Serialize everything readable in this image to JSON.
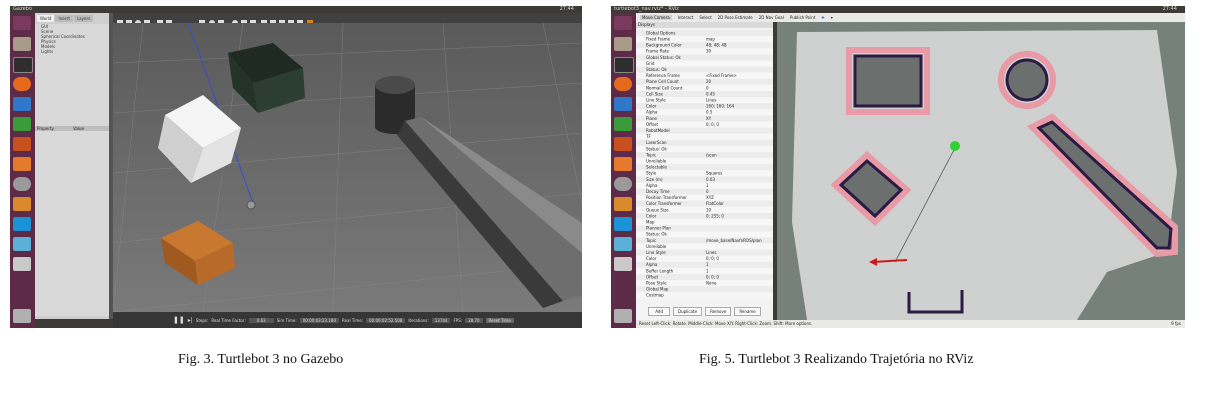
{
  "figures": [
    {
      "app_title": "Gazebo",
      "side_tabs": [
        "World",
        "Insert",
        "Layers"
      ],
      "tree_items": [
        "GUI",
        "Scene",
        "Spherical Coordinates",
        "Physics",
        "Models",
        "Lights"
      ],
      "prop_headers": [
        "Property",
        "Value"
      ],
      "status": {
        "steps": "Steps:",
        "rtf_label": "Real Time Factor:",
        "rtf": "0.63",
        "sim_label": "Sim Time:",
        "sim": "00:00:03:23.180",
        "real_label": "Real Time:",
        "real": "00:00:02:52.508",
        "iter_label": "Iterations:",
        "iter": "13744",
        "fps_label": "FPS:",
        "fps": "28.70",
        "reset": "Reset Time"
      },
      "tray": "27:44",
      "caption": "Fig. 3.   Turtlebot 3 no Gazebo"
    },
    {
      "app_title": "turtlebot3_nav.rviz* - RViz",
      "tools": [
        "Move Camera",
        "Interact",
        "Select",
        "2D Pose Estimate",
        "2D Nav Goal",
        "Publish Point"
      ],
      "panel_title": "Displays",
      "rows": [
        [
          "Global Options",
          ""
        ],
        [
          "Fixed Frame",
          "map"
        ],
        [
          "Background Color",
          "48; 48; 48"
        ],
        [
          "Frame Rate",
          "30"
        ],
        [
          "Global Status: Ok",
          ""
        ],
        [
          "Grid",
          ""
        ],
        [
          "Status: Ok",
          ""
        ],
        [
          "Reference Frame",
          "<Fixed Frame>"
        ],
        [
          "Plane Cell Count",
          "20"
        ],
        [
          "Normal Cell Count",
          "0"
        ],
        [
          "Cell Size",
          "0.45"
        ],
        [
          "Line Style",
          "Lines"
        ],
        [
          "Color",
          "160; 160; 164"
        ],
        [
          "Alpha",
          "0.5"
        ],
        [
          "Plane",
          "XY"
        ],
        [
          "Offset",
          "0; 0; 0"
        ],
        [
          "RobotModel",
          ""
        ],
        [
          "TF",
          ""
        ],
        [
          "LaserScan",
          ""
        ],
        [
          "Status: Ok",
          ""
        ],
        [
          "Topic",
          "/scan"
        ],
        [
          "Unreliable",
          ""
        ],
        [
          "Selectable",
          ""
        ],
        [
          "Style",
          "Squares"
        ],
        [
          "Size (m)",
          "0.03"
        ],
        [
          "Alpha",
          "1"
        ],
        [
          "Decay Time",
          "0"
        ],
        [
          "Position Transformer",
          "XYZ"
        ],
        [
          "Color Transformer",
          "FlatColor"
        ],
        [
          "Queue Size",
          "10"
        ],
        [
          "Color",
          "0; 255; 0"
        ],
        [
          "Map",
          ""
        ],
        [
          "Planner Plan",
          ""
        ],
        [
          "Status: Ok",
          ""
        ],
        [
          "Topic",
          "/move_base/NavfnROS/plan"
        ],
        [
          "Unreliable",
          ""
        ],
        [
          "Line Style",
          "Lines"
        ],
        [
          "Color",
          "0; 0; 0"
        ],
        [
          "Alpha",
          "1"
        ],
        [
          "Buffer Length",
          "1"
        ],
        [
          "Offset",
          "0; 0; 0"
        ],
        [
          "Pose Style",
          "None"
        ],
        [
          "Global Map",
          ""
        ],
        [
          "Costmap",
          ""
        ]
      ],
      "buttons": [
        "Add",
        "Duplicate",
        "Remove",
        "Rename"
      ],
      "bottom_status": "Reset   Left-Click: Rotate. Middle-Click: Move X/Y. Right-Click: Zoom. Shift: More options.",
      "fps": "9 fps",
      "tray": "27:44",
      "caption": "Fig. 5.   Turtlebot 3 Realizando Trajetória no RViz"
    }
  ]
}
